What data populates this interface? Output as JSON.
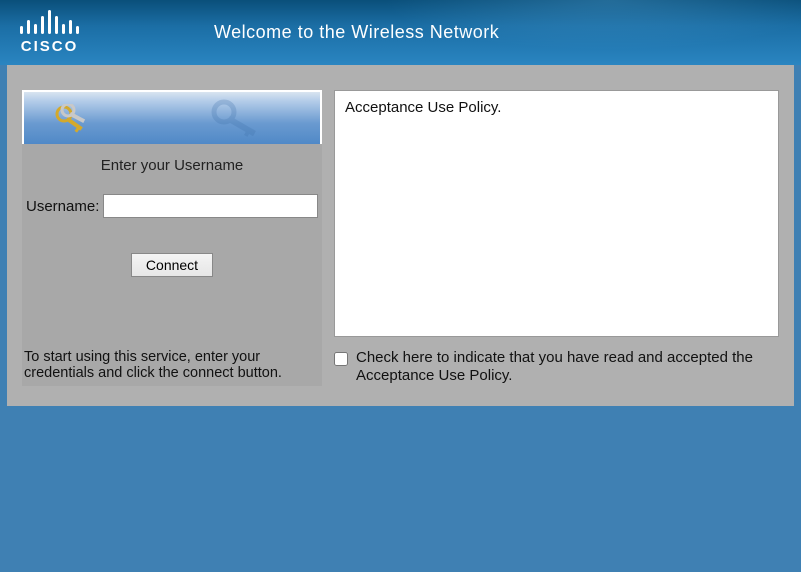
{
  "brand": {
    "name": "CISCO"
  },
  "header": {
    "welcome": "Welcome to the Wireless Network"
  },
  "login": {
    "heading": "Enter your Username",
    "username_label": "Username:",
    "username_value": "",
    "connect_label": "Connect",
    "instructions": "To start using this service, enter your credentials and click the connect button."
  },
  "policy": {
    "text": "Acceptance Use Policy.",
    "checkbox_label": "Check here to indicate that you have read and accepted the Acceptance Use Policy.",
    "checked": false
  }
}
